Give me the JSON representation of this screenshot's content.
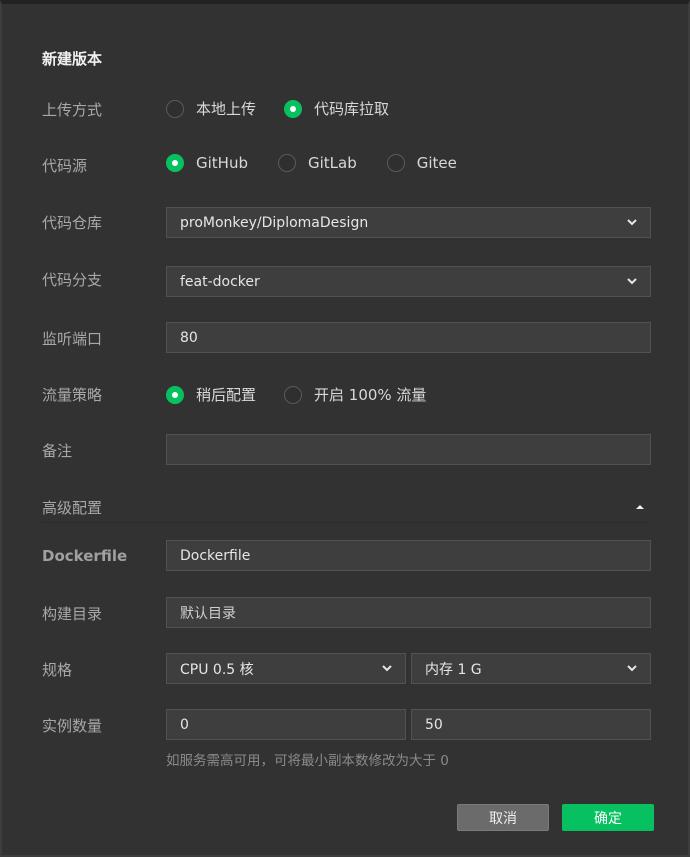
{
  "dialog": {
    "title": "新建版本"
  },
  "upload": {
    "label": "上传方式",
    "options": [
      {
        "label": "本地上传",
        "checked": false
      },
      {
        "label": "代码库拉取",
        "checked": true
      }
    ]
  },
  "source": {
    "label": "代码源",
    "options": [
      {
        "label": "GitHub",
        "checked": true
      },
      {
        "label": "GitLab",
        "checked": false
      },
      {
        "label": "Gitee",
        "checked": false
      }
    ]
  },
  "repo": {
    "label": "代码仓库",
    "value": "proMonkey/DiplomaDesign"
  },
  "branch": {
    "label": "代码分支",
    "value": "feat-docker"
  },
  "port": {
    "label": "监听端口",
    "value": "80"
  },
  "traffic": {
    "label": "流量策略",
    "options": [
      {
        "label": "稍后配置",
        "checked": true
      },
      {
        "label": "开启 100% 流量",
        "checked": false
      }
    ]
  },
  "remark": {
    "label": "备注",
    "value": ""
  },
  "advanced": {
    "label": "高级配置",
    "icon": "caret-up-icon"
  },
  "dockerfile": {
    "label": "Dockerfile",
    "value": "Dockerfile"
  },
  "build_dir": {
    "label": "构建目录",
    "placeholder": "默认目录"
  },
  "spec": {
    "label": "规格",
    "cpu": "CPU 0.5 核",
    "memory": "内存 1 G"
  },
  "instances": {
    "label": "实例数量",
    "min": "0",
    "max": "50",
    "hint": "如服务需高可用，可将最小副本数修改为大于 0"
  },
  "buttons": {
    "cancel": "取消",
    "confirm": "确定"
  },
  "colors": {
    "accent": "#07c160",
    "background": "#323232",
    "field": "#3e3e3e"
  }
}
